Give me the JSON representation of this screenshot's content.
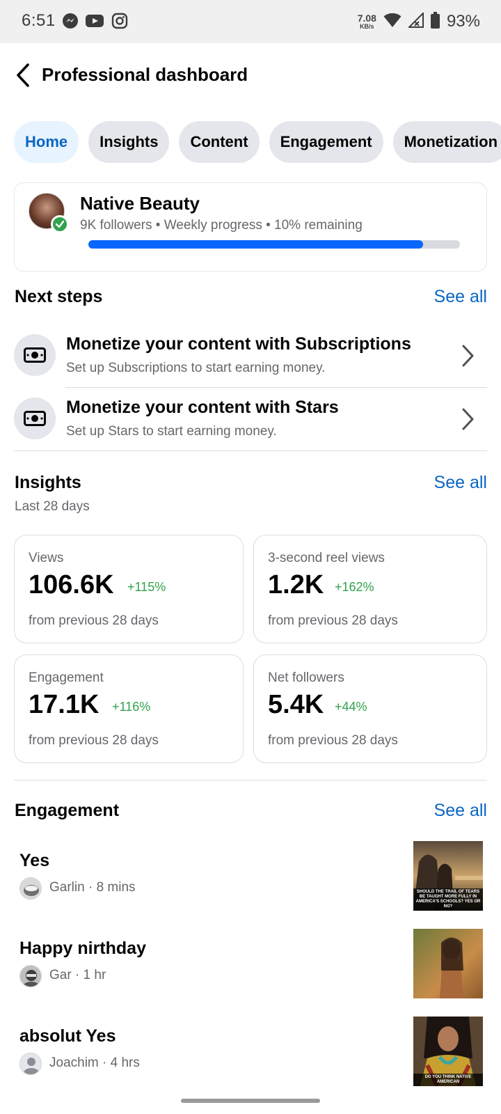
{
  "status_bar": {
    "time": "6:51",
    "network_speed_value": "7.08",
    "network_speed_unit": "KB/s",
    "battery": "93%"
  },
  "header": {
    "title": "Professional dashboard"
  },
  "tabs": [
    {
      "label": "Home",
      "active": true
    },
    {
      "label": "Insights",
      "active": false
    },
    {
      "label": "Content",
      "active": false
    },
    {
      "label": "Engagement",
      "active": false
    },
    {
      "label": "Monetization",
      "active": false
    }
  ],
  "profile": {
    "name": "Native Beauty",
    "meta": "9K followers • Weekly progress • 10% remaining",
    "progress_fraction": 0.9
  },
  "next_steps": {
    "title": "Next steps",
    "see_all": "See all",
    "items": [
      {
        "title": "Monetize your content with Subscriptions",
        "description": "Set up Subscriptions to start earning money.",
        "icon": "money-icon"
      },
      {
        "title": "Monetize your content with Stars",
        "description": "Set up Stars to start earning money.",
        "icon": "money-icon"
      }
    ]
  },
  "insights": {
    "title": "Insights",
    "see_all": "See all",
    "subtitle": "Last 28 days",
    "cards": [
      {
        "label": "Views",
        "value": "106.6K",
        "change": "+115%",
        "footer": "from previous 28 days"
      },
      {
        "label": "3-second reel views",
        "value": "1.2K",
        "change": "+162%",
        "footer": "from previous 28 days"
      },
      {
        "label": "Engagement",
        "value": "17.1K",
        "change": "+116%",
        "footer": "from previous 28 days"
      },
      {
        "label": "Net followers",
        "value": "5.4K",
        "change": "+44%",
        "footer": "from previous 28 days"
      }
    ]
  },
  "engagement": {
    "title": "Engagement",
    "see_all": "See all",
    "items": [
      {
        "comment": "Yes",
        "meta": "Garlin · 8 mins",
        "thumb_caption": "SHOULD THE TRAIL OF TEARS BE TAUGHT MORE FULLY IN AMERICA'S SCHOOLS? YES OR NO?"
      },
      {
        "comment": "Happy nirthday",
        "meta": "Gar · 1 hr",
        "thumb_caption": ""
      },
      {
        "comment": "absolut Yes",
        "meta": "Joachim · 4 hrs",
        "thumb_caption": "DO YOU THINK NATIVE AMERICAN"
      }
    ]
  },
  "colors": {
    "accent": "#0a66c2",
    "progress": "#0866ff",
    "positive": "#31a24c",
    "active_tab_bg": "#e7f3ff",
    "chip_bg": "#e4e6eb"
  }
}
